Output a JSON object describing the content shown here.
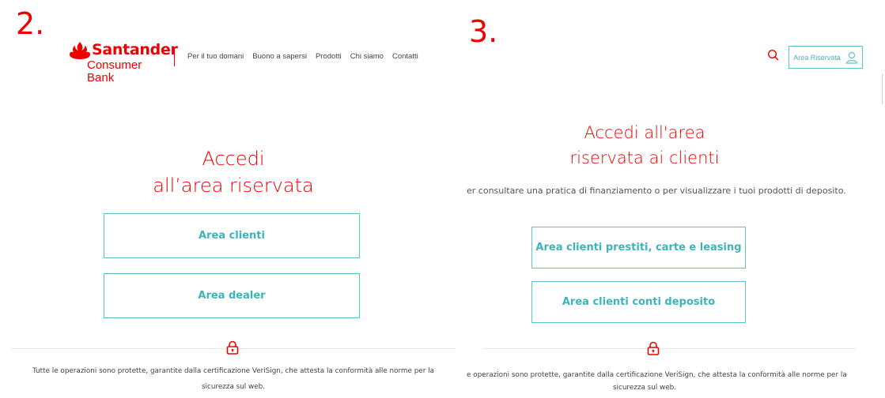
{
  "panel_2": {
    "step": "2.",
    "brand": {
      "name": "Santander",
      "sub": "Consumer Bank"
    },
    "nav": [
      "Per il tuo domani",
      "Buono a sapersi",
      "Prodotti",
      "Chi siamo",
      "Contatti"
    ],
    "title_line1": "Accedi",
    "title_line2": "all’area riservata",
    "buttons": {
      "clienti": "Area clienti",
      "dealer": "Area dealer"
    },
    "security": {
      "line1": "Tutte le operazioni sono protette, garantite dalla certificazione VeriSign, che attesta la conformità alle norme per la",
      "line2": "sicurezza sul web."
    }
  },
  "panel_3": {
    "step": "3.",
    "reserved_label": "Area Riservata",
    "title_line1": "Accedi all'area",
    "title_line2": "riservata ai clienti",
    "subtitle": "er consultare una pratica di finanziamento o per visualizzare i tuoi prodotti di deposito.",
    "buttons": {
      "prestiti": "Area clienti prestiti, carte e leasing",
      "deposito": "Area clienti conti deposito"
    },
    "security": {
      "line1": "e operazioni sono protette, garantite dalla certificazione VeriSign, che attesta la conformità alle norme per la",
      "line2": "sicurezza sul web."
    }
  },
  "colors": {
    "brand_red": "#ec0000",
    "accent_teal": "#3fb3ba"
  },
  "icons": [
    "santander-flame-icon",
    "search-icon",
    "user-icon",
    "padlock-icon"
  ]
}
